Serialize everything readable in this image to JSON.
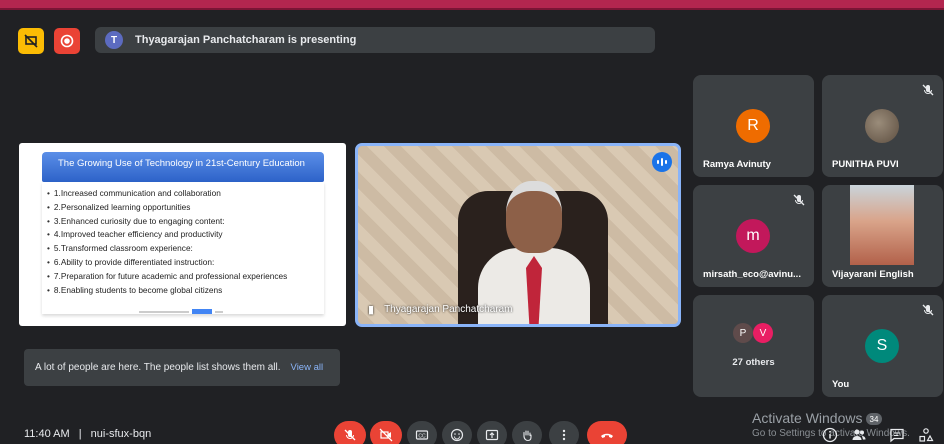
{
  "top_bar": {
    "presenter_initial": "T",
    "presenting_text": "Thyagarajan Panchatcharam is presenting"
  },
  "slide": {
    "title": "The Growing Use of Technology in 21st-Century Education",
    "items": [
      "1.Increased communication and collaboration",
      "2.Personalized learning opportunities",
      "3.Enhanced curiosity due to engaging content:",
      "4.Improved teacher efficiency and productivity",
      "5.Transformed classroom experience:",
      "6.Ability to provide differentiated instruction:",
      "7.Preparation for future academic and professional experiences",
      "8.Enabling students to become global citizens"
    ]
  },
  "presenter": {
    "name": "Thyagarajan Panchatcharam"
  },
  "tiles": {
    "ramya": {
      "initial": "R",
      "name": "Ramya Avinuty",
      "color": "#ef6c00"
    },
    "punitha": {
      "name": "PUNITHA PUVI"
    },
    "mirsath": {
      "initial": "m",
      "name": "mirsath_eco@avinu...",
      "color": "#c2185b"
    },
    "vijayarani": {
      "name": "Vijayarani English"
    },
    "others": {
      "initial_p": "P",
      "initial_v": "V",
      "label": "27 others"
    },
    "you": {
      "initial": "S",
      "name": "You",
      "color": "#00897b"
    }
  },
  "notice": {
    "text": "A lot of people are here. The people list shows them all.",
    "link": "View all"
  },
  "bottom": {
    "time": "11:40 AM",
    "separator": "|",
    "meeting_code": "nui-sfux-bqn",
    "participant_count": "34"
  },
  "watermark": {
    "line1": "Activate Windows",
    "line2": "Go to Settings to activate Windows."
  }
}
